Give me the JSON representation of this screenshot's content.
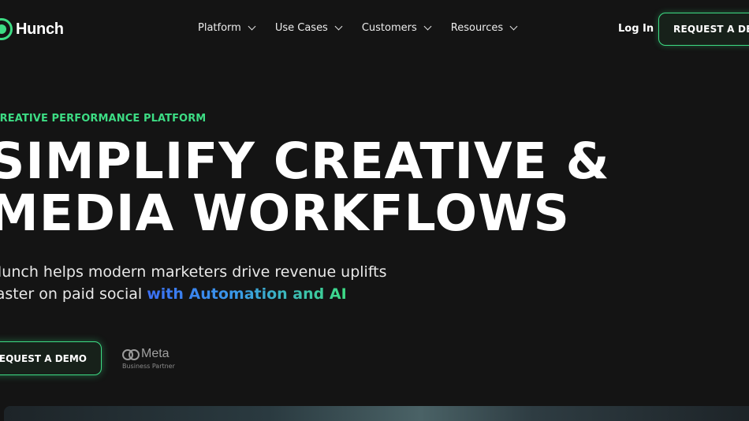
{
  "brand": {
    "name": "Hunch",
    "accent": "#3ddc84"
  },
  "nav": {
    "items": [
      {
        "label": "Platform"
      },
      {
        "label": "Use Cases"
      },
      {
        "label": "Customers"
      },
      {
        "label": "Resources"
      }
    ],
    "login_label": "Log In",
    "demo_label": "REQUEST A DEMO"
  },
  "hero": {
    "eyebrow": "CREATIVE PERFORMANCE PLATFORM",
    "headline_line1": "SIMPLIFY CREATIVE &",
    "headline_line2": "MEDIA WORKFLOWS",
    "sub_line1": "Hunch helps modern marketers drive revenue uplifts",
    "sub_line2_plain": "faster on paid social ",
    "sub_line2_highlight": "with Automation and AI",
    "cta_label": "REQUEST A DEMO",
    "partner_name": "Meta",
    "partner_sub": "Business Partner"
  }
}
